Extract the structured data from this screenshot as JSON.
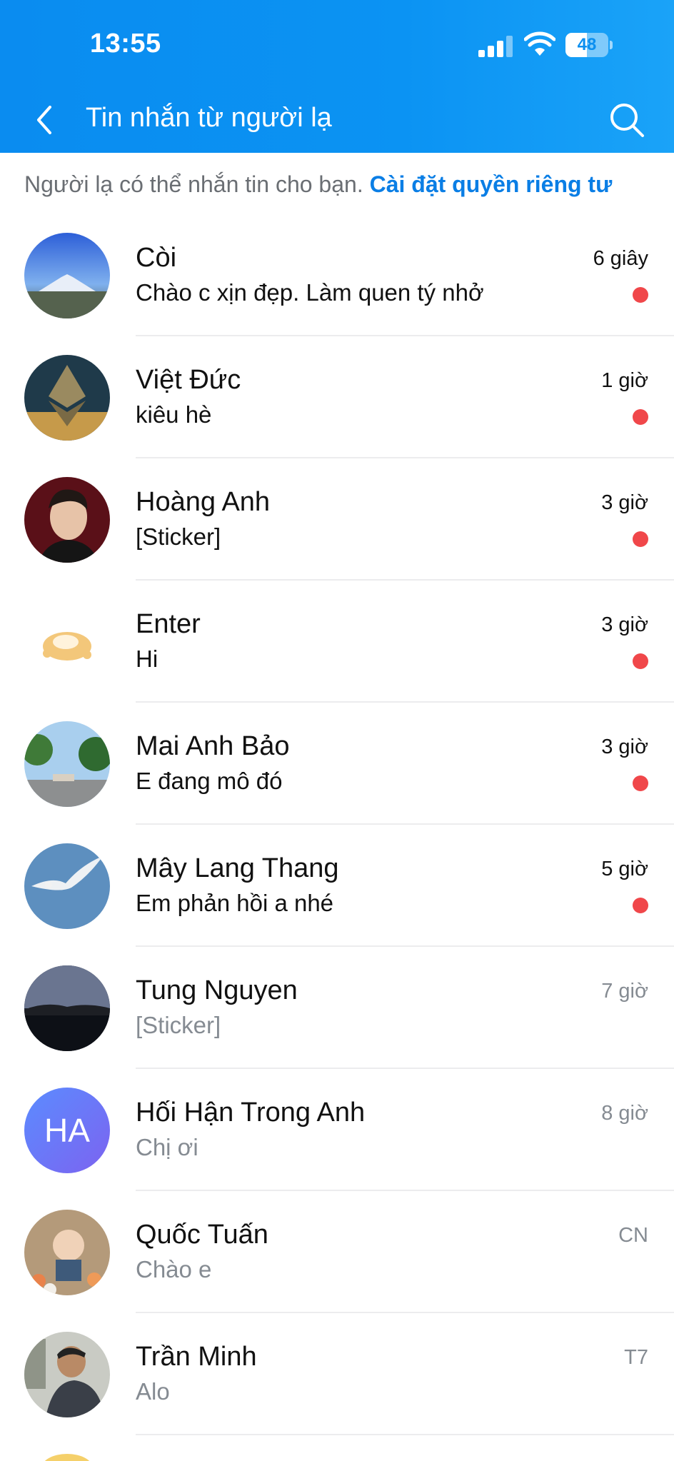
{
  "status_bar": {
    "time": "13:55",
    "battery": "48"
  },
  "header": {
    "title": "Tin nhắn từ người lạ"
  },
  "notice": {
    "text": "Người lạ có thể nhắn tin cho bạn.",
    "link": "Cài đặt quyền riêng tư"
  },
  "messages": [
    {
      "name": "Còi",
      "preview": "Chào c xịn đẹp.  Làm quen tý nhở",
      "time": "6 giây",
      "unread": true
    },
    {
      "name": "Việt Đức",
      "preview": "kiêu hè",
      "time": "1 giờ",
      "unread": true
    },
    {
      "name": "Hoàng Anh",
      "preview": "[Sticker]",
      "time": "3 giờ",
      "unread": true
    },
    {
      "name": "Enter",
      "preview": "Hi",
      "time": "3 giờ",
      "unread": true
    },
    {
      "name": "Mai Anh Bảo",
      "preview": "E đang mô đó",
      "time": "3 giờ",
      "unread": true
    },
    {
      "name": "Mây Lang Thang",
      "preview": "Em phản hồi a nhé",
      "time": "5 giờ",
      "unread": true
    },
    {
      "name": "Tung Nguyen",
      "preview": "[Sticker]",
      "time": "7 giờ",
      "unread": false
    },
    {
      "name": "Hối Hận Trong Anh",
      "preview": "Chị ơi",
      "time": "8 giờ",
      "unread": false,
      "initials": "HA"
    },
    {
      "name": "Quốc Tuấn",
      "preview": "Chào e",
      "time": "CN",
      "unread": false
    },
    {
      "name": "Trần Minh",
      "preview": "Alo",
      "time": "T7",
      "unread": false
    }
  ],
  "icons": {
    "back": "chevron-left-icon",
    "search": "search-icon"
  },
  "colors": {
    "header": "#0b93f3",
    "link": "#0a7ee5",
    "unread_dot": "#f0474a"
  }
}
